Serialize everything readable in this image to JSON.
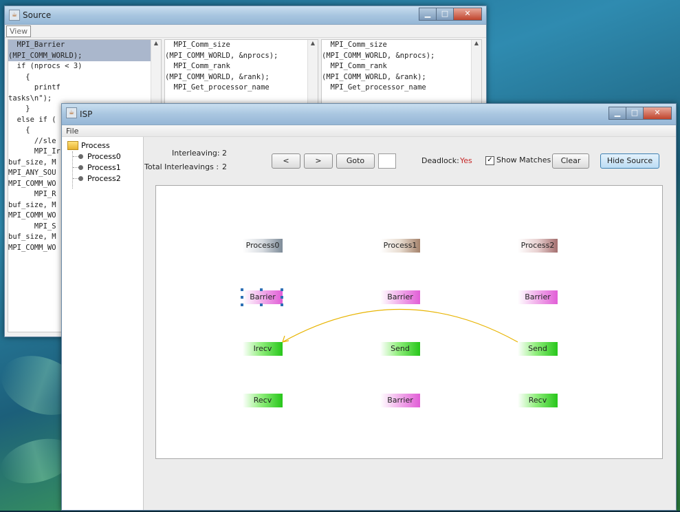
{
  "source_window": {
    "title": "Source",
    "menu": [
      "View"
    ],
    "icon": "java-icon",
    "controls": [
      "minimize",
      "maximize",
      "close"
    ],
    "pane1_lines": [
      "  MPI_Barrier",
      "(MPI_COMM_WORLD);",
      "",
      "  if (nprocs < 3)",
      "    {",
      "      printf",
      "tasks\\n\");",
      "    }",
      "  else if (",
      "    {",
      "      //sle",
      "",
      "      MPI_Ir",
      "buf_size, M",
      "",
      "MPI_ANY_SOU",
      "MPI_COMM_WO",
      "",
      "      MPI_R",
      "buf_size, M",
      "MPI_COMM_WO",
      "",
      "      MPI_S",
      "buf_size, M",
      "MPI_COMM_WO"
    ],
    "pane2_lines": [
      "  MPI_Comm_size",
      "(MPI_COMM_WORLD, &nprocs);",
      "  MPI_Comm_rank",
      "(MPI_COMM_WORLD, &rank);",
      "  MPI_Get_processor_name"
    ],
    "pane3_lines": [
      "  MPI_Comm_size",
      "(MPI_COMM_WORLD, &nprocs);",
      "  MPI_Comm_rank",
      "(MPI_COMM_WORLD, &rank);",
      "  MPI_Get_processor_name"
    ]
  },
  "isp_window": {
    "title": "ISP",
    "menu": [
      "File"
    ],
    "tree": {
      "root": "Process",
      "children": [
        "Process0",
        "Process1",
        "Process2"
      ]
    },
    "toolbar": {
      "interleaving_label": "Interleaving:",
      "interleaving_value": "2",
      "total_label": "Total Interleavings :",
      "total_value": "2",
      "prev_label": "<",
      "next_label": ">",
      "goto_label": "Goto",
      "goto_value": "",
      "deadlock_label": "Deadlock:",
      "deadlock_value": "Yes",
      "deadlock_color": "#c62828",
      "show_matches_label": "Show Matches",
      "show_matches_checked": true,
      "clear_label": "Clear",
      "hide_source_label": "Hide Source"
    },
    "graph": {
      "processes": [
        {
          "name": "Process0",
          "ops": [
            "Barrier",
            "Irecv",
            "Recv"
          ]
        },
        {
          "name": "Process1",
          "ops": [
            "Barrier",
            "Send",
            "Barrier"
          ]
        },
        {
          "name": "Process2",
          "ops": [
            "Barrier",
            "Send",
            "Recv"
          ]
        }
      ],
      "selected": "Process0 Barrier",
      "match_arrow": {
        "from": "Process2 Send",
        "to": "Process0 Irecv",
        "color": "#e8b400"
      },
      "colors": {
        "barrier": "#e15ed7",
        "p2p": "#27c61a"
      }
    }
  }
}
